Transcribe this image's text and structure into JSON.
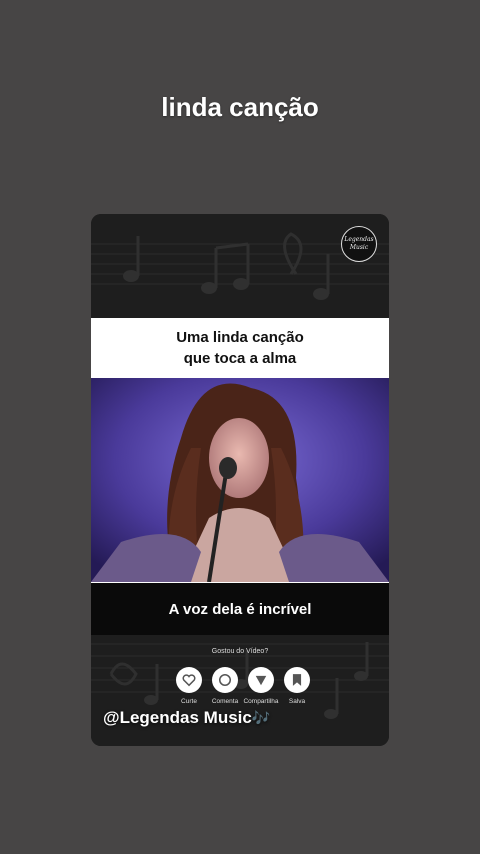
{
  "story": {
    "title": "linda canção"
  },
  "card": {
    "logo_line1": "Legendas",
    "logo_line2": "Music",
    "top_caption_line1": "Uma linda canção",
    "top_caption_line2": "que toca a alma",
    "bottom_caption": "A voz dela é incrível",
    "prompt": "Gostou do Vídeo?",
    "actions": [
      {
        "label": "Curte",
        "icon": "heart-icon"
      },
      {
        "label": "Comenta",
        "icon": "comment-icon"
      },
      {
        "label": "Compartilha",
        "icon": "share-icon"
      },
      {
        "label": "Salva",
        "icon": "bookmark-icon"
      }
    ],
    "handle": "@Legendas Music",
    "handle_emoji": "🎶"
  },
  "colors": {
    "background": "#474545",
    "card_dark": "#1c1c1c",
    "caption_light": "#ffffff",
    "caption_dark": "#0a0a0a",
    "stage_purple": "#4a3a9a"
  }
}
